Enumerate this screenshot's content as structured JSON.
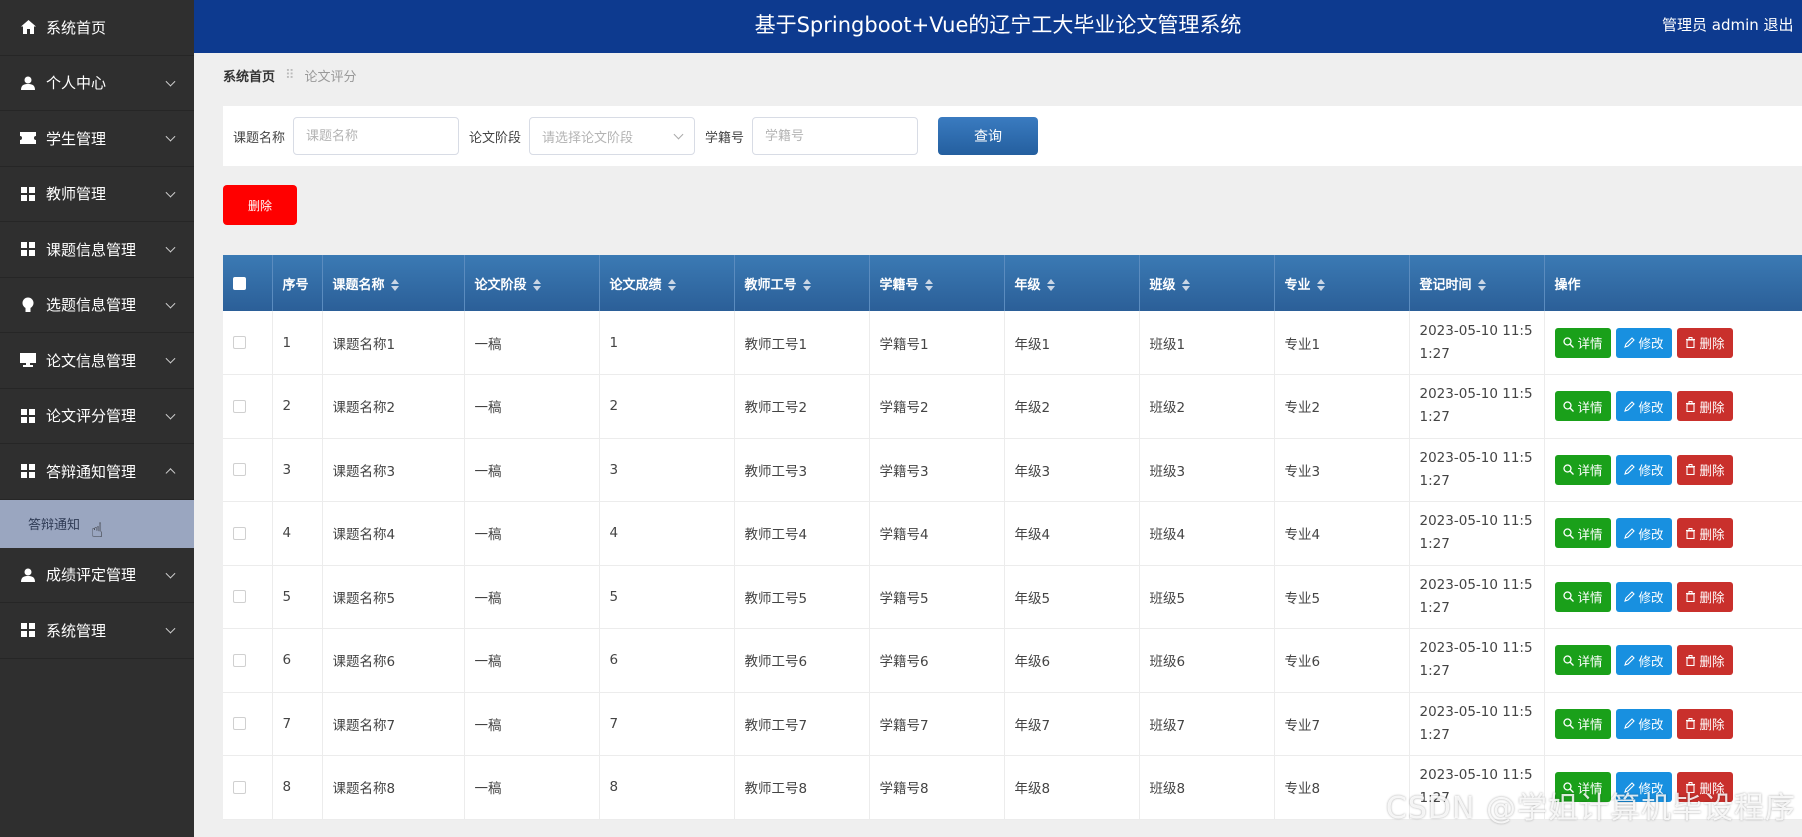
{
  "header": {
    "title": "基于Springboot+Vue的辽宁工大毕业论文管理系统",
    "user": "管理员 admin  退出"
  },
  "sidebar": {
    "items": [
      {
        "label": "系统首页",
        "icon": "home-icon",
        "chevron": "none"
      },
      {
        "label": "个人中心",
        "icon": "person-icon",
        "chevron": "down"
      },
      {
        "label": "学生管理",
        "icon": "ticket-icon",
        "chevron": "down"
      },
      {
        "label": "教师管理",
        "icon": "grid-icon",
        "chevron": "down"
      },
      {
        "label": "课题信息管理",
        "icon": "grid-icon",
        "chevron": "down"
      },
      {
        "label": "选题信息管理",
        "icon": "bulb-icon",
        "chevron": "down"
      },
      {
        "label": "论文信息管理",
        "icon": "monitor-icon",
        "chevron": "down"
      },
      {
        "label": "论文评分管理",
        "icon": "grid-icon",
        "chevron": "down"
      },
      {
        "label": "答辩通知管理",
        "icon": "grid-icon",
        "chevron": "up"
      }
    ],
    "submenu": {
      "label": "答辩通知"
    },
    "items_after": [
      {
        "label": "成绩评定管理",
        "icon": "person-icon",
        "chevron": "down"
      },
      {
        "label": "系统管理",
        "icon": "grid-icon",
        "chevron": "down"
      }
    ]
  },
  "breadcrumb": {
    "home": "系统首页",
    "separator": "⠿",
    "current": "论文评分"
  },
  "search": {
    "topic_label": "课题名称",
    "topic_placeholder": "课题名称",
    "stage_label": "论文阶段",
    "stage_placeholder": "请选择论文阶段",
    "sid_label": "学籍号",
    "sid_placeholder": "学籍号",
    "query_label": "查询"
  },
  "actions": {
    "delete_label": "删除"
  },
  "table": {
    "headers": [
      "序号",
      "课题名称",
      "论文阶段",
      "论文成绩",
      "教师工号",
      "学籍号",
      "年级",
      "班级",
      "专业",
      "登记时间",
      "操作"
    ],
    "buttons": {
      "detail": "详情",
      "edit": "修改",
      "delete": "删除"
    },
    "rows": [
      [
        "1",
        "课题名称1",
        "一稿",
        "1",
        "教师工号1",
        "学籍号1",
        "年级1",
        "班级1",
        "专业1",
        "2023-05-10 11:51:27"
      ],
      [
        "2",
        "课题名称2",
        "一稿",
        "2",
        "教师工号2",
        "学籍号2",
        "年级2",
        "班级2",
        "专业2",
        "2023-05-10 11:51:27"
      ],
      [
        "3",
        "课题名称3",
        "一稿",
        "3",
        "教师工号3",
        "学籍号3",
        "年级3",
        "班级3",
        "专业3",
        "2023-05-10 11:51:27"
      ],
      [
        "4",
        "课题名称4",
        "一稿",
        "4",
        "教师工号4",
        "学籍号4",
        "年级4",
        "班级4",
        "专业4",
        "2023-05-10 11:51:27"
      ],
      [
        "5",
        "课题名称5",
        "一稿",
        "5",
        "教师工号5",
        "学籍号5",
        "年级5",
        "班级5",
        "专业5",
        "2023-05-10 11:51:27"
      ],
      [
        "6",
        "课题名称6",
        "一稿",
        "6",
        "教师工号6",
        "学籍号6",
        "年级6",
        "班级6",
        "专业6",
        "2023-05-10 11:51:27"
      ],
      [
        "7",
        "课题名称7",
        "一稿",
        "7",
        "教师工号7",
        "学籍号7",
        "年级7",
        "班级7",
        "专业7",
        "2023-05-10 11:51:27"
      ],
      [
        "8",
        "课题名称8",
        "一稿",
        "8",
        "教师工号8",
        "学籍号8",
        "年级8",
        "班级8",
        "专业8",
        "2023-05-10 11:51:27"
      ]
    ]
  },
  "watermark": "CSDN @学姐计算机毕设程序",
  "colors": {
    "header": "#0d3a8f",
    "sidebar": "#2f2f2f",
    "table_head": "#2e6ba6",
    "detail": "#1aa01a",
    "edit": "#1890e0",
    "delete": "#c9302c",
    "batch_delete": "#ff0000"
  }
}
